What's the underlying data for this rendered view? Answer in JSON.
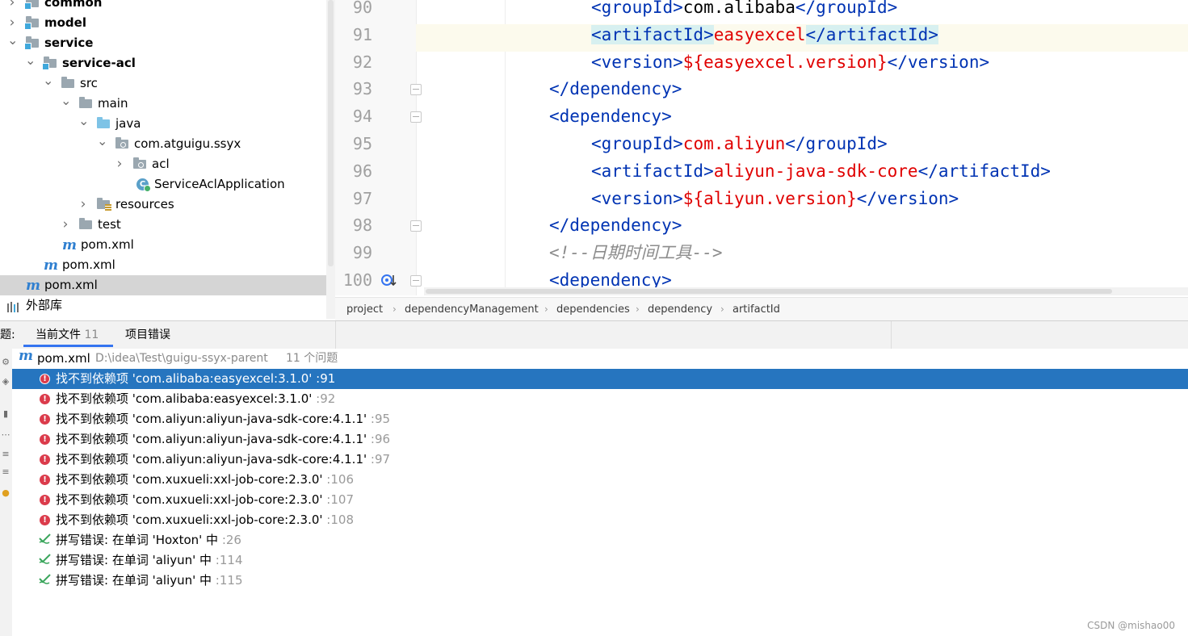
{
  "tree": {
    "items": [
      {
        "label": "common",
        "bold": true,
        "expanded": false,
        "icon": "module-folder-icon"
      },
      {
        "label": "model",
        "bold": true,
        "expanded": false,
        "icon": "module-folder-icon"
      },
      {
        "label": "service",
        "bold": true,
        "expanded": true,
        "icon": "module-folder-icon"
      },
      {
        "label": "service-acl",
        "bold": true,
        "expanded": true,
        "icon": "module-folder-icon"
      },
      {
        "label": "src",
        "expanded": true,
        "icon": "folder-icon"
      },
      {
        "label": "main",
        "expanded": true,
        "icon": "folder-icon"
      },
      {
        "label": "java",
        "expanded": true,
        "icon": "source-folder-icon"
      },
      {
        "label": "com.atguigu.ssyx",
        "expanded": true,
        "icon": "package-icon"
      },
      {
        "label": "acl",
        "expanded": false,
        "icon": "package-icon"
      },
      {
        "label": "ServiceAclApplication",
        "icon": "spring-class-icon"
      },
      {
        "label": "resources",
        "expanded": false,
        "icon": "resources-folder-icon"
      },
      {
        "label": "test",
        "expanded": false,
        "icon": "folder-icon"
      },
      {
        "label": "pom.xml",
        "icon": "maven-icon"
      },
      {
        "label": "pom.xml",
        "icon": "maven-icon"
      },
      {
        "label": "pom.xml",
        "icon": "maven-icon",
        "selected": true
      },
      {
        "label": "外部库",
        "icon": "library-icon"
      }
    ]
  },
  "editor": {
    "current_line": 91,
    "lines": [
      {
        "num": "90",
        "indent": 2,
        "parts": [
          [
            "tag",
            "<groupId>"
          ],
          [
            "txt",
            "com.alibaba"
          ],
          [
            "tag",
            "</groupId>"
          ]
        ]
      },
      {
        "num": "91",
        "indent": 2,
        "parts": [
          [
            "tag-hl",
            "<artifactId>"
          ],
          [
            "val",
            "easyexcel"
          ],
          [
            "tag-hl",
            "</artifactId>"
          ]
        ]
      },
      {
        "num": "92",
        "indent": 2,
        "parts": [
          [
            "tag",
            "<version>"
          ],
          [
            "val",
            "${easyexcel.version}"
          ],
          [
            "tag",
            "</version>"
          ]
        ]
      },
      {
        "num": "93",
        "indent": 1,
        "fold": true,
        "parts": [
          [
            "tag",
            "</dependency>"
          ]
        ]
      },
      {
        "num": "94",
        "indent": 1,
        "fold": true,
        "parts": [
          [
            "tag",
            "<dependency>"
          ]
        ]
      },
      {
        "num": "95",
        "indent": 2,
        "parts": [
          [
            "tag",
            "<groupId>"
          ],
          [
            "val",
            "com.aliyun"
          ],
          [
            "tag",
            "</groupId>"
          ]
        ]
      },
      {
        "num": "96",
        "indent": 2,
        "parts": [
          [
            "tag",
            "<artifactId>"
          ],
          [
            "val",
            "aliyun-java-sdk-core"
          ],
          [
            "tag",
            "</artifactId>"
          ]
        ]
      },
      {
        "num": "97",
        "indent": 2,
        "parts": [
          [
            "tag",
            "<version>"
          ],
          [
            "val",
            "${aliyun.version}"
          ],
          [
            "tag",
            "</version>"
          ]
        ]
      },
      {
        "num": "98",
        "indent": 1,
        "fold": true,
        "parts": [
          [
            "tag",
            "</dependency>"
          ]
        ]
      },
      {
        "num": "99",
        "indent": 1,
        "parts": [
          [
            "cmt",
            "<!--日期时间工具-->"
          ]
        ]
      },
      {
        "num": "100",
        "indent": 1,
        "fold": true,
        "gutter_icon": true,
        "parts": [
          [
            "tag",
            "<dependency>"
          ]
        ]
      }
    ]
  },
  "breadcrumb": [
    "project",
    "dependencyManagement",
    "dependencies",
    "dependency",
    "artifactId"
  ],
  "problems": {
    "side_label": "题:",
    "tabs": [
      {
        "label": "当前文件",
        "count": "11",
        "active": true
      },
      {
        "label": "项目错误",
        "count": "",
        "active": false
      }
    ],
    "group": {
      "file": "pom.xml",
      "path": "D:\\idea\\Test\\guigu-ssyx-parent",
      "count": "11 个问题"
    },
    "items": [
      {
        "type": "error",
        "text": "找不到依赖项 'com.alibaba:easyexcel:3.1.0'",
        "line": ":91",
        "selected": true
      },
      {
        "type": "error",
        "text": "找不到依赖项 'com.alibaba:easyexcel:3.1.0'",
        "line": ":92"
      },
      {
        "type": "error",
        "text": "找不到依赖项 'com.aliyun:aliyun-java-sdk-core:4.1.1'",
        "line": ":95"
      },
      {
        "type": "error",
        "text": "找不到依赖项 'com.aliyun:aliyun-java-sdk-core:4.1.1'",
        "line": ":96"
      },
      {
        "type": "error",
        "text": "找不到依赖项 'com.aliyun:aliyun-java-sdk-core:4.1.1'",
        "line": ":97"
      },
      {
        "type": "error",
        "text": "找不到依赖项 'com.xuxueli:xxl-job-core:2.3.0'",
        "line": ":106"
      },
      {
        "type": "error",
        "text": "找不到依赖项 'com.xuxueli:xxl-job-core:2.3.0'",
        "line": ":107"
      },
      {
        "type": "error",
        "text": "找不到依赖项 'com.xuxueli:xxl-job-core:2.3.0'",
        "line": ":108"
      },
      {
        "type": "typo",
        "text": "拼写错误: 在单词 'Hoxton' 中",
        "line": ":26"
      },
      {
        "type": "typo",
        "text": "拼写错误: 在单词 'aliyun' 中",
        "line": ":114"
      },
      {
        "type": "typo",
        "text": "拼写错误: 在单词 'aliyun' 中",
        "line": ":115"
      }
    ]
  },
  "watermark": "CSDN @mishao00",
  "colors": {
    "tag": "#0033b3",
    "value": "#e00000",
    "comment": "#8c8c8c",
    "selection": "#2675bf",
    "error": "#db3b4b",
    "typo": "#3aa55c"
  }
}
